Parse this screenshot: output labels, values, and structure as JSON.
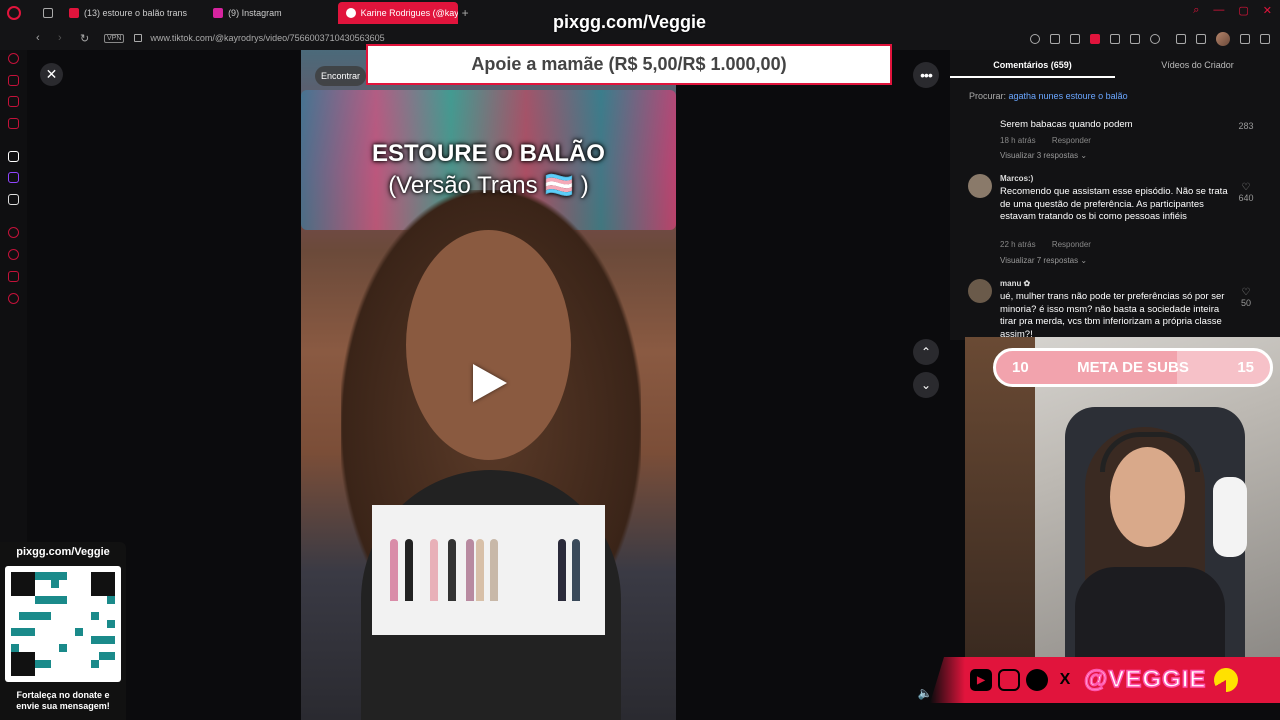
{
  "browser": {
    "tabs": [
      {
        "label": "(13) estoure o balão trans",
        "icon": "youtube-icon",
        "color": "#e1143c",
        "active": false
      },
      {
        "label": "(9) Instagram",
        "icon": "instagram-icon",
        "color": "#d6249f",
        "active": false
      },
      {
        "label": "Karine Rodrigues (@kayr",
        "icon": "tiktok-icon",
        "color": "#ffffff",
        "active": true
      }
    ],
    "new_tab": "+",
    "url": "www.tiktok.com/@kayrodrys/video/7566003710430563605",
    "vpn": "VPN",
    "accent": "#e1143c"
  },
  "overlay": {
    "donate_url": "pixgg.com/Veggie",
    "donate_bar": "Apoie a mamãe (R$ 5,00/R$ 1.000,00)"
  },
  "video": {
    "search_chip": "Encontrar",
    "title_line1": "ESTOURE O BALÃO",
    "title_line2": "(Versão Trans 🏳️‍⚧️ )"
  },
  "comments": {
    "tab_comments": "Comentários (659)",
    "tab_creator": "Vídeos do Criador",
    "search_prefix": "Procurar: ",
    "search_query": "agatha nunes estoure o balão",
    "items": [
      {
        "user": "",
        "text": "Serem babacas quando podem",
        "time": "18 h atrás",
        "reply": "Responder",
        "replies": "Visualizar 3 respostas ⌄",
        "likes": "283"
      },
      {
        "user": "Marcos:)",
        "text": "Recomendo que assistam esse episódio. Não se trata de uma questão de preferência. As participantes estavam tratando os bi como pessoas infiéis",
        "time": "22 h atrás",
        "reply": "Responder",
        "replies": "Visualizar 7 respostas ⌄",
        "likes": "640"
      },
      {
        "user": "manu ✿",
        "text": "ué, mulher trans não pode ter preferências só por ser minoria? é isso msm? não basta a sociedade inteira tirar pra merda, vcs tbm inferiorizam a própria classe assim?!",
        "time": "",
        "reply": "",
        "replies": "",
        "likes": "50"
      }
    ]
  },
  "stream": {
    "sub_goal_current": "10",
    "sub_goal_label": "META DE SUBS",
    "sub_goal_target": "15",
    "sub_goal_progress": 0.66,
    "handle": "@VEGGIE",
    "qr_title": "pixgg.com/Veggie",
    "qr_caption": "Fortaleça no donate e envie sua mensagem!"
  }
}
